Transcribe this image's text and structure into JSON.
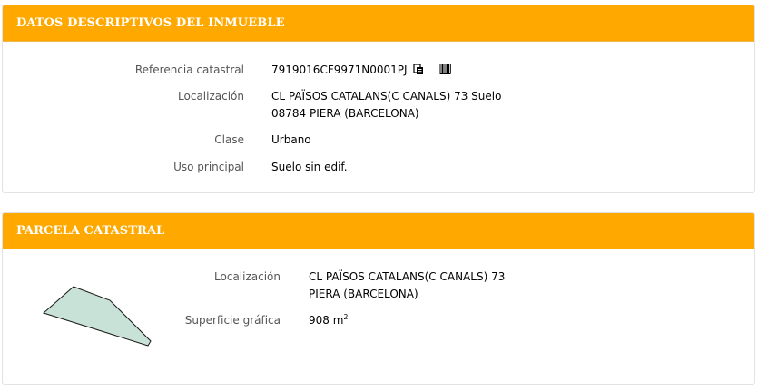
{
  "inmueble": {
    "title": "DATOS DESCRIPTIVOS DEL INMUEBLE",
    "referencia_label": "Referencia catastral",
    "referencia_value": "7919016CF9971N0001PJ",
    "copy_icon": "copy-icon",
    "barcode_icon": "barcode-icon",
    "localizacion_label": "Localización",
    "localizacion_line1": "CL PAÏSOS CATALANS(C CANALS) 73 Suelo",
    "localizacion_line2": "08784 PIERA (BARCELONA)",
    "clase_label": "Clase",
    "clase_value": "Urbano",
    "uso_label": "Uso principal",
    "uso_value": "Suelo sin edif."
  },
  "parcela": {
    "title": "PARCELA CATASTRAL",
    "localizacion_label": "Localización",
    "localizacion_line1": "CL PAÏSOS CATALANS(C CANALS) 73",
    "localizacion_line2": "PIERA (BARCELONA)",
    "superficie_label": "Superficie gráfica",
    "superficie_value": "908 m",
    "superficie_unit_sup": "2",
    "parcel_fill": "#c9e2d7",
    "parcel_stroke": "#1a1a1a"
  },
  "colors": {
    "header_bg": "#ffa800",
    "header_text": "#ffffff",
    "label_text": "#555555"
  }
}
